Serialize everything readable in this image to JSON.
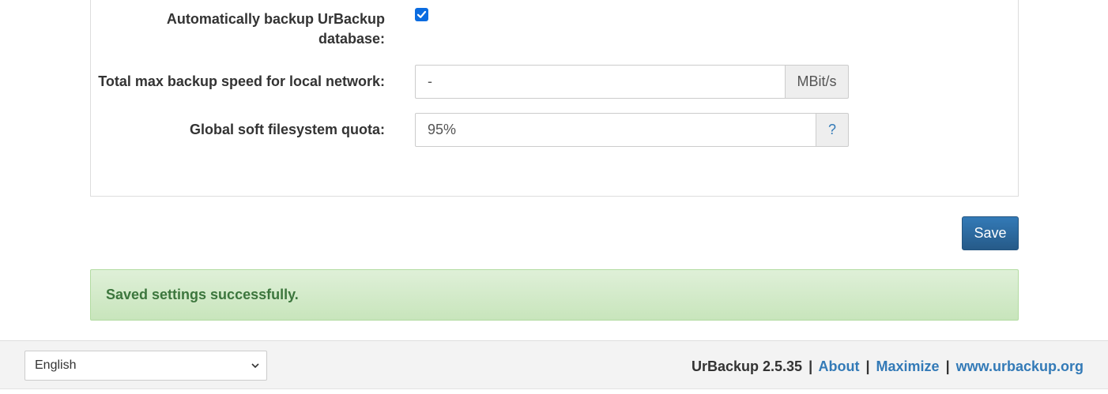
{
  "settings": {
    "auto_backup_db": {
      "label": "Automatically backup UrBackup database:",
      "label_line1": "Automatically backup UrBackup",
      "label_line2": "database:",
      "checked": true
    },
    "max_speed_local": {
      "label": "Total max backup speed for local network:",
      "value": "-",
      "unit": "MBit/s"
    },
    "soft_quota": {
      "label": "Global soft filesystem quota:",
      "value": "95%",
      "help": "?"
    }
  },
  "actions": {
    "save_label": "Save"
  },
  "alert": {
    "message": "Saved settings successfully."
  },
  "footer": {
    "language": "English",
    "version_text": "UrBackup 2.5.35",
    "separator": "|",
    "links": {
      "about": "About",
      "maximize": "Maximize",
      "website": "www.urbackup.org"
    }
  },
  "colors": {
    "primary": "#337ab7",
    "checkbox": "#0b6ce0",
    "success_text": "#3c763d",
    "success_bg": "#dff0d8"
  }
}
